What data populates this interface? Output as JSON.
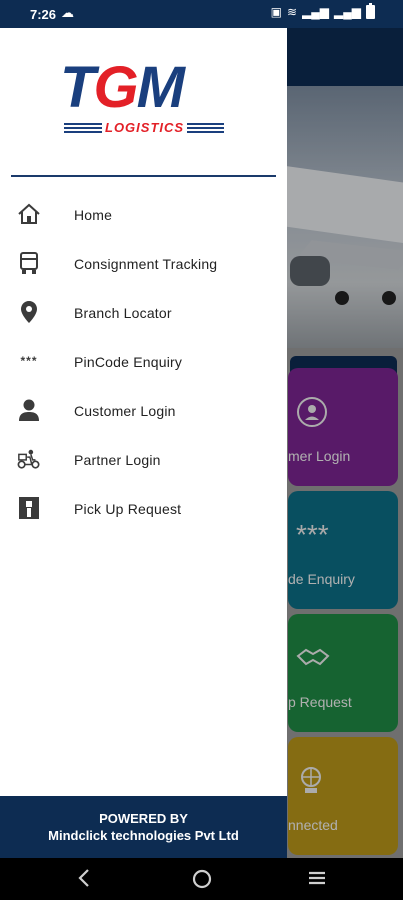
{
  "status_bar": {
    "time": "7:26",
    "icons": [
      "cloud-icon",
      "vo-lte-icon",
      "wifi-icon",
      "signal-icon",
      "signal-icon",
      "battery-icon"
    ]
  },
  "brand": {
    "logo_main": "TGM",
    "logo_main_letters": [
      "T",
      "G",
      "M"
    ],
    "logo_sub": "LOGISTICS",
    "colors": {
      "navy": "#1a3f7e",
      "red": "#e32027",
      "header": "#0d2c52"
    }
  },
  "drawer": {
    "menu": [
      {
        "label": "Home",
        "icon": "home-icon"
      },
      {
        "label": "Consignment Tracking",
        "icon": "truck-icon"
      },
      {
        "label": "Branch Locator",
        "icon": "location-pin-icon"
      },
      {
        "label": "PinCode Enquiry",
        "icon": "asterisks-icon",
        "icon_text": "***"
      },
      {
        "label": "Customer Login",
        "icon": "person-icon"
      },
      {
        "label": "Partner Login",
        "icon": "delivery-scooter-icon"
      },
      {
        "label": "Pick Up Request",
        "icon": "pickup-icon"
      }
    ],
    "footer": {
      "line1": "POWERED BY",
      "line2": "Mindclick technologies Pvt Ltd"
    }
  },
  "background": {
    "tiles": [
      {
        "label": "mer Login",
        "color": "#7b2491",
        "icon": "person-circle-icon"
      },
      {
        "label": "de Enquiry",
        "color": "#0c6e86",
        "icon": "asterisks-icon",
        "icon_text": "***"
      },
      {
        "label": "p Request",
        "color": "#1f8a45",
        "icon": "handshake-icon"
      },
      {
        "label": "nnected",
        "color": "#b9961a",
        "icon": "globe-person-icon"
      }
    ]
  }
}
